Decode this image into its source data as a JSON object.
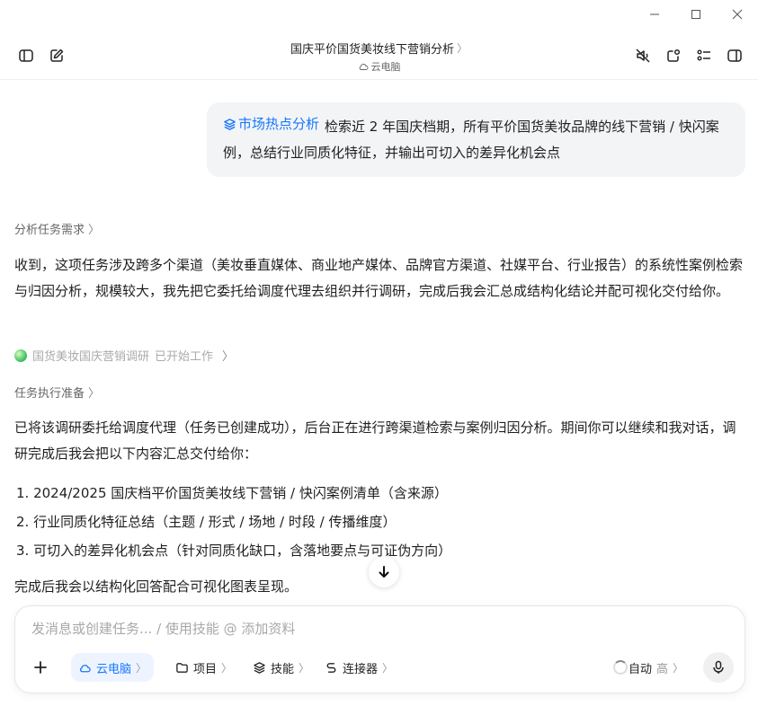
{
  "header": {
    "title": "国庆平价国货美妆线下营销分析",
    "subtitle": "云电脑"
  },
  "user_message": {
    "skill_tag": "市场热点分析",
    "text": "检索近 2 年国庆档期，所有平价国货美妆品牌的线下营销 / 快闪案例，总结行业同质化特征，并输出可切入的差异化机会点"
  },
  "sections": {
    "analysis_label": "分析任务需求",
    "analysis_text": "收到，这项任务涉及跨多个渠道（美妆垂直媒体、商业地产媒体、品牌官方渠道、社媒平台、行业报告）的系统性案例检索与归因分析，规模较大，我先把它委托给调度代理去组织并行调研，完成后我会汇总成结构化结论并配可视化交付给你。",
    "agent_name": "国货美妆国庆营销调研",
    "agent_state": "已开始工作",
    "prep_label": "任务执行准备",
    "prep_text": "已将该调研委托给调度代理（任务已创建成功），后台正在进行跨渠道检索与案例归因分析。期间你可以继续和我对话，调研完成后我会把以下内容汇总交付给你：",
    "list": [
      "1. 2024/2025 国庆档平价国货美妆线下营销 / 快闪案例清单（含来源）",
      "2. 行业同质化特征总结（主题 / 形式 / 场地 / 时段 / 传播维度）",
      "3. 可切入的差异化机会点（针对同质化缺口，含落地要点与可证伪方向）"
    ],
    "closing_text": "完成后我会以结构化回答配合可视化图表呈现。"
  },
  "composer": {
    "placeholder": "发消息或创建任务... / 使用技能 @ 添加资料",
    "cloud_label": "云电脑",
    "project_label": "项目",
    "skill_label": "技能",
    "connector_label": "连接器",
    "mode_label": "自动",
    "mode_level": "高"
  },
  "colors": {
    "accent": "#1677ff",
    "bubble_bg": "#f3f4f6"
  }
}
